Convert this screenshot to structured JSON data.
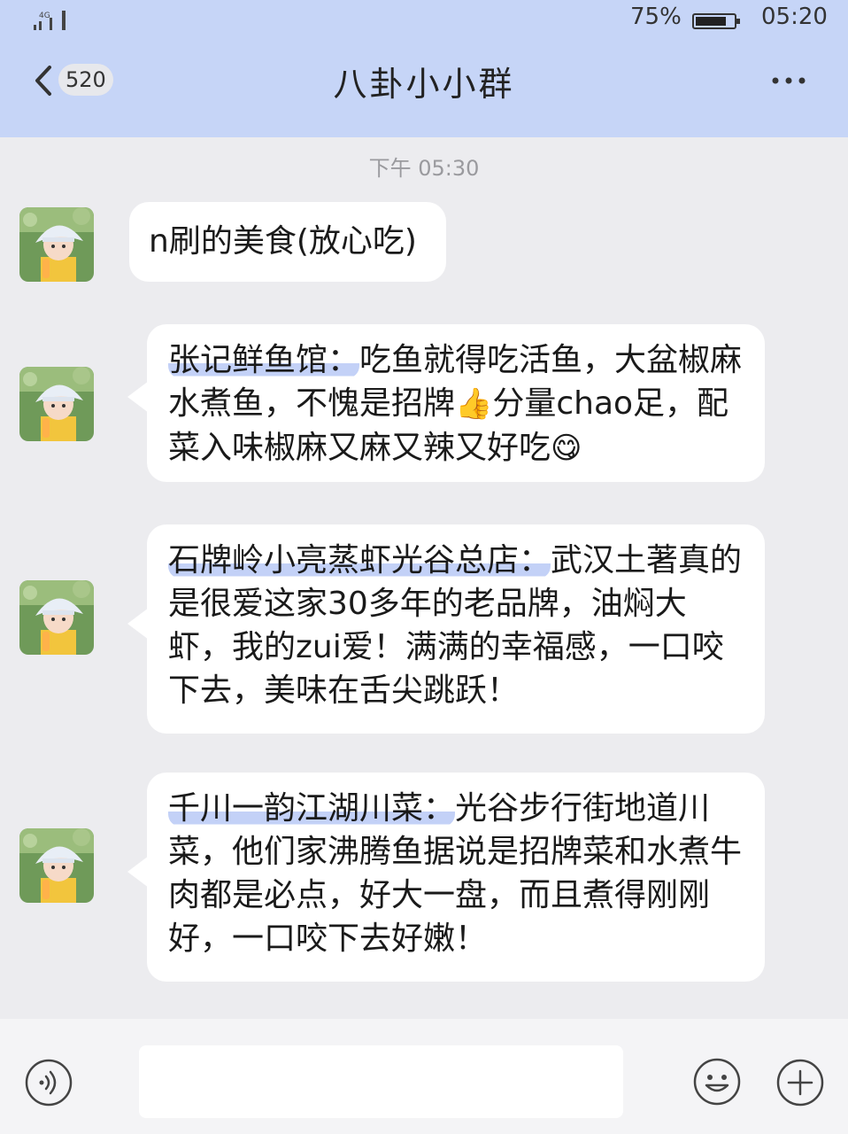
{
  "status_bar": {
    "network": "4G",
    "battery": "75%",
    "time": "05:20"
  },
  "header": {
    "back_count": "520",
    "title": "八卦小小群"
  },
  "chat": {
    "timestamp": "下午 05:30",
    "messages": [
      {
        "plain": "n刷的美食(放心吃)"
      },
      {
        "highlight": "张记鲜鱼馆：",
        "text": "吃鱼就得吃活鱼，大盆椒麻水煮鱼，不愧是招牌",
        "emoji1": "👍",
        "text2": "分量chao足，配菜入味椒麻又麻又辣又好吃",
        "emoji2": "😋"
      },
      {
        "highlight": "石牌岭小亮蒸虾光谷总店：",
        "text": "武汉土著真的是很爱这家30多年的老品牌，油焖大虾，我的zui爱！满满的幸福感，一口咬下去，美味在舌尖跳跃！"
      },
      {
        "highlight": "千川一韵江湖川菜：",
        "text": "光谷步行街地道川菜，他们家沸腾鱼据说是招牌菜和水煮牛肉都是必点，好大一盘，而且煮得刚刚好，一口咬下去好嫩！"
      }
    ]
  },
  "icons": {
    "back": "chevron-left-icon",
    "more": "more-dots-icon",
    "voice": "voice-icon",
    "emoji": "smiley-icon",
    "plus": "plus-icon"
  },
  "colors": {
    "header_bg": "#c6d5f7",
    "chat_bg": "#ececef",
    "highlight": "#c3d1f7"
  }
}
